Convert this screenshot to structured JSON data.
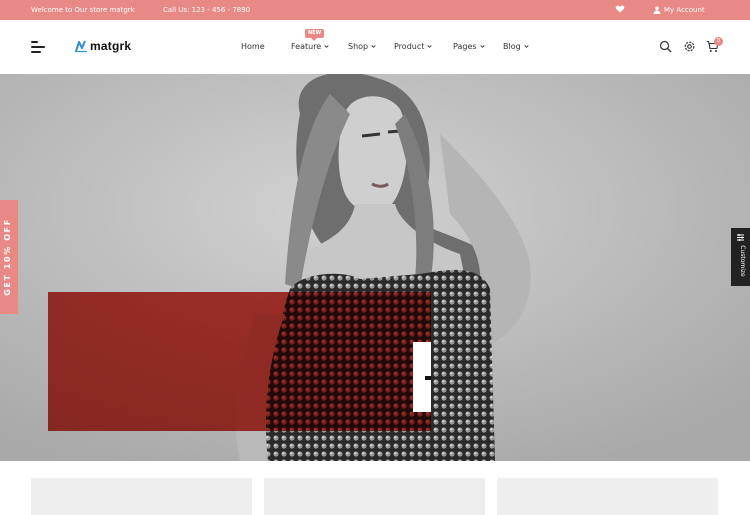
{
  "topbar": {
    "welcome": "Welcome to Our store matgrk",
    "call": "Call Us: 123 - 456 - 7890",
    "account": "My Account",
    "bg_color": "#e98986"
  },
  "header": {
    "logo_text": "matgrk",
    "nav": [
      {
        "label": "Home",
        "has_dropdown": false
      },
      {
        "label": "Feature",
        "has_dropdown": true,
        "badge": "NEW"
      },
      {
        "label": "Shop",
        "has_dropdown": true
      },
      {
        "label": "Product",
        "has_dropdown": true
      },
      {
        "label": "Pages",
        "has_dropdown": true
      },
      {
        "label": "Blog",
        "has_dropdown": true
      }
    ],
    "icons": [
      "search-icon",
      "settings-icon",
      "cart-icon"
    ],
    "cart_count": "0"
  },
  "side_tab": {
    "label": "GET 10% OFF"
  },
  "customize": {
    "label": "Customize"
  },
  "colors": {
    "accent": "#e98986",
    "hero_red": "#be1a10",
    "dark": "#222222"
  }
}
